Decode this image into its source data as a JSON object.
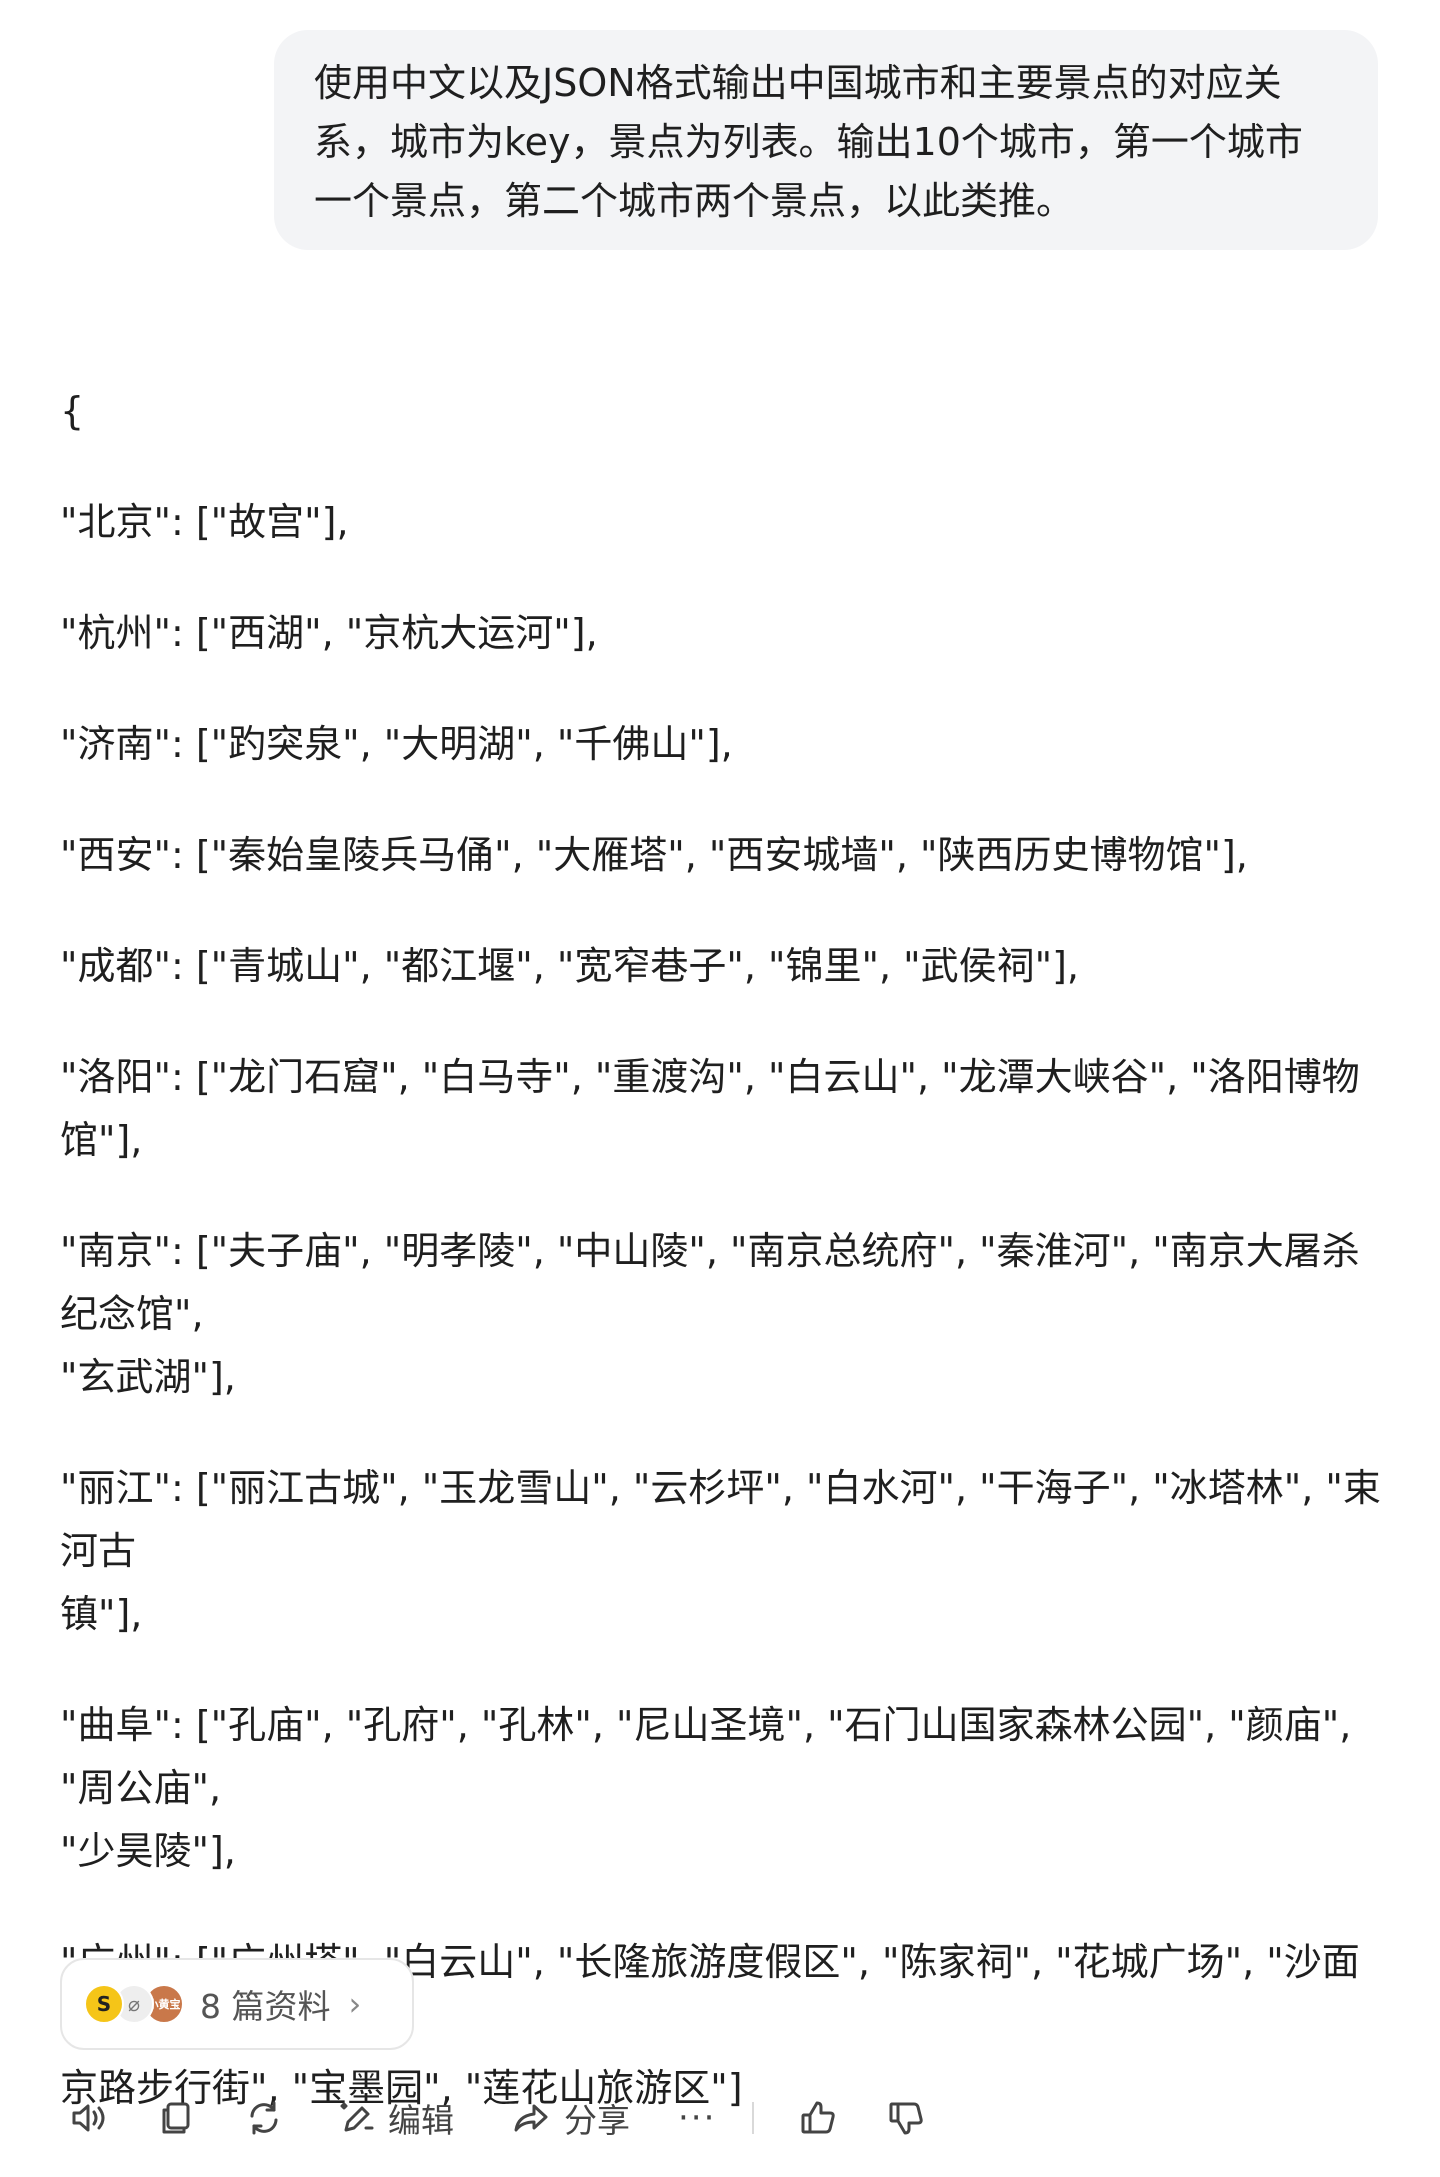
{
  "user_message": "使用中文以及JSON格式输出中国城市和主要景点的对应关\n系，城市为key，景点为列表。输出10个城市，第一个城市\n一个景点，第二个城市两个景点，以此类推。",
  "answer": {
    "open_brace": "{",
    "lines": [
      "\"北京\": [\"故宫\"],",
      "\"杭州\": [\"西湖\", \"京杭大运河\"],",
      "\"济南\": [\"趵突泉\", \"大明湖\", \"千佛山\"],",
      "\"西安\": [\"秦始皇陵兵马俑\", \"大雁塔\", \"西安城墙\", \"陕西历史博物馆\"],",
      "\"成都\": [\"青城山\", \"都江堰\", \"宽窄巷子\", \"锦里\", \"武侯祠\"],",
      "\"洛阳\": [\"龙门石窟\", \"白马寺\", \"重渡沟\", \"白云山\", \"龙潭大峡谷\", \"洛阳博物馆\"],",
      "\"南京\": [\"夫子庙\", \"明孝陵\", \"中山陵\", \"南京总统府\", \"秦淮河\", \"南京大屠杀纪念馆\",\n\"玄武湖\"],",
      "\"丽江\": [\"丽江古城\", \"玉龙雪山\", \"云杉坪\", \"白水河\", \"干海子\", \"冰塔林\", \"束河古\n镇\"],",
      "\"曲阜\": [\"孔庙\", \"孔府\", \"孔林\", \"尼山圣境\", \"石门山国家森林公园\", \"颜庙\", \"周公庙\",\n\"少昊陵\"],",
      "\"广州\": [\"广州塔\", \"白云山\", \"长隆旅游度假区\", \"陈家祠\", \"花城广场\", \"沙面岛\", \"北\n京路步行街\", \"宝墨园\", \"莲花山旅游区\"]"
    ],
    "close_brace": "}"
  },
  "references": {
    "label": "8 篇资料",
    "avatar_1": "S",
    "avatar_2": "⌀",
    "avatar_3": "小黄宝"
  },
  "toolbar": {
    "edit_label": "编辑",
    "share_label": "分享",
    "more_label": "···"
  },
  "icons": {
    "read_aloud": "speaker-icon",
    "copy": "copy-icon",
    "regenerate": "refresh-icon",
    "edit": "edit-sparkle-icon",
    "share": "share-arrow-icon",
    "like": "thumbs-up-icon",
    "dislike": "thumbs-down-icon"
  }
}
